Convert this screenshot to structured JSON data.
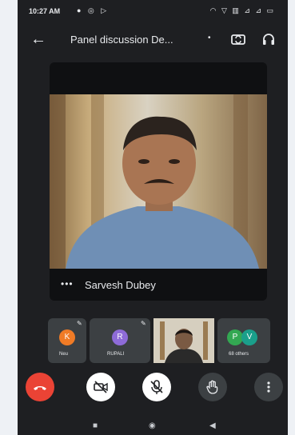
{
  "status": {
    "time": "10:27 AM",
    "left_icons": "● ◎ ▷",
    "right_icons": "◠ ▽ ▥ ⊿ ⊿ ▭"
  },
  "header": {
    "title": "Panel discussion De...",
    "title_dot": "•",
    "back_icon": "back-arrow-icon",
    "camera_switch_icon": "camera-switch-icon",
    "audio_icon": "headphones-icon"
  },
  "speaker": {
    "name": "Sarvesh Dubey",
    "more": "•••"
  },
  "participants": [
    {
      "initial": "K",
      "name": "Neu",
      "color": "#f07b26",
      "muted": true
    },
    {
      "initial": "R",
      "name": "RUPALI",
      "color": "#8e6bd8",
      "muted": true
    },
    {
      "initial": "",
      "name": "",
      "color": "",
      "muted": false,
      "video": true
    },
    {
      "initials": [
        "P",
        "V"
      ],
      "name": "68 others",
      "colors": [
        "#33a852",
        "#1a9f8b"
      ]
    }
  ],
  "controls": [
    {
      "name": "end-call",
      "color": "#ea4335"
    },
    {
      "name": "camera-off",
      "color": "#ffffff"
    },
    {
      "name": "mic-off",
      "color": "#ffffff"
    },
    {
      "name": "raise-hand",
      "color": "#3c4043"
    },
    {
      "name": "more-options",
      "color": "#3c4043"
    }
  ]
}
